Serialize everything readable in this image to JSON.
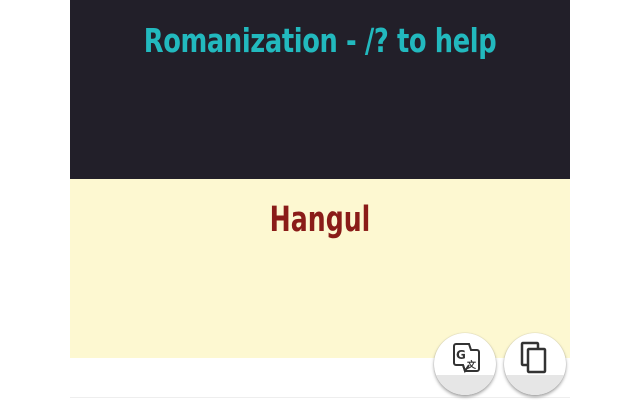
{
  "header": {
    "title": "Romanization - /? to help"
  },
  "output": {
    "label": "Hangul"
  },
  "actions": {
    "translate_icon": "google-translate-icon",
    "copy_icon": "copy-icon"
  },
  "colors": {
    "top_panel": "#221f29",
    "bottom_panel": "#fdf8d1",
    "title": "#22b9be",
    "hangul": "#8a1c18"
  }
}
